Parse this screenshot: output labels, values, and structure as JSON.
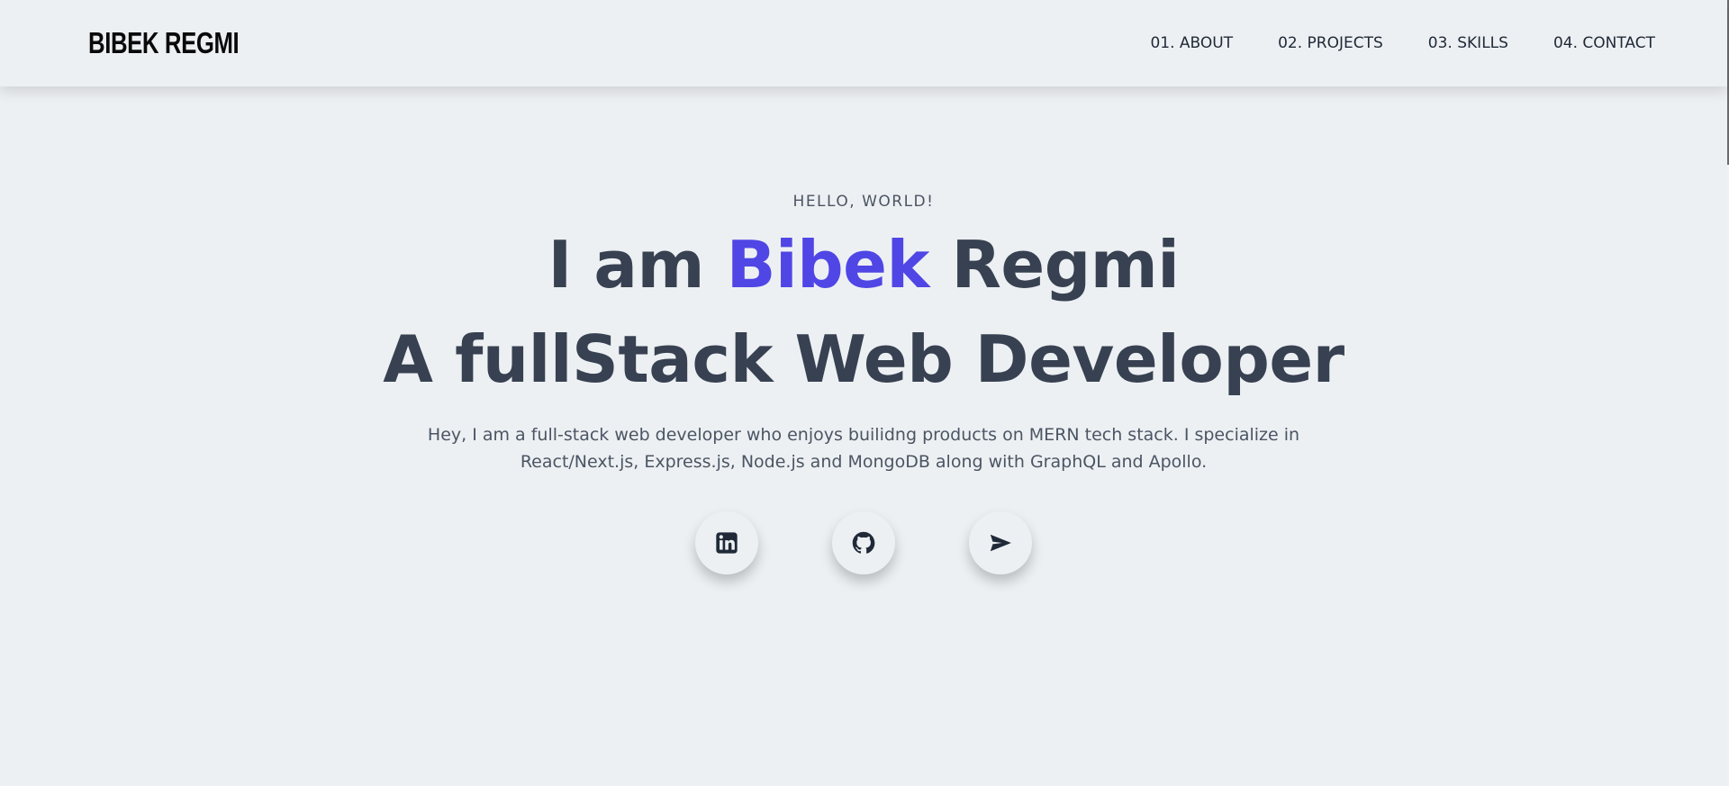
{
  "header": {
    "logo": "BIBEK REGMI",
    "nav": [
      {
        "label": "01. ABOUT"
      },
      {
        "label": "02. PROJECTS"
      },
      {
        "label": "03. SKILLS"
      },
      {
        "label": "04. CONTACT"
      }
    ]
  },
  "hero": {
    "greeting": "HELLO, WORLD!",
    "line1_prefix": "I am ",
    "line1_accent": "Bibek",
    "line1_suffix": " Regmi",
    "line2": "A fullStack Web Developer",
    "intro": "Hey, I am a full-stack web developer who enjoys builidng products on MERN tech stack. I specialize in React/Next.js, Express.js, Node.js and MongoDB along with GraphQL and Apollo.",
    "socials": [
      {
        "icon": "linkedin-icon"
      },
      {
        "icon": "github-icon"
      },
      {
        "icon": "send-icon"
      }
    ]
  },
  "colors": {
    "background": "#edf0f3",
    "accent": "#4f46e5",
    "text": "#374151"
  }
}
